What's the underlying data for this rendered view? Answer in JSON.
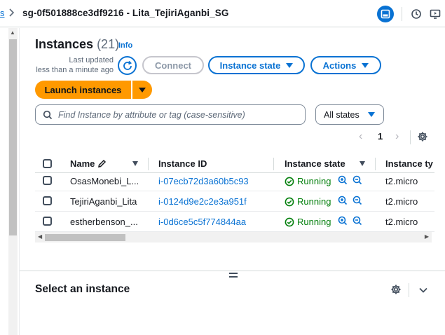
{
  "breadcrumb": {
    "prev_fragment": "s",
    "current": "sg-0f501888ce3df9216 - Lita_TejiriAganbi_SG"
  },
  "top_icons": [
    "panel-icon",
    "clock-icon",
    "tutorial-icon"
  ],
  "header": {
    "title": "Instances",
    "count": "(21)",
    "info": "Info",
    "updated_line1": "Last updated",
    "updated_line2": "less than a minute ago"
  },
  "buttons": {
    "connect": "Connect",
    "instance_state": "Instance state",
    "actions": "Actions",
    "launch": "Launch instances"
  },
  "search": {
    "placeholder": "Find Instance by attribute or tag (case-sensitive)"
  },
  "filter": {
    "selected": "All states"
  },
  "pagination": {
    "current": "1"
  },
  "table": {
    "columns": [
      "Name",
      "Instance ID",
      "Instance state",
      "Instance ty"
    ],
    "rows": [
      {
        "name": "OsasMonebi_L...",
        "id": "i-07ecb72d3a60b5c93",
        "state": "Running",
        "type": "t2.micro"
      },
      {
        "name": "TejiriAganbi_Lita",
        "id": "i-0124d9e2c2e3a951f",
        "state": "Running",
        "type": "t2.micro"
      },
      {
        "name": "estherbenson_...",
        "id": "i-0d6ce5c5f774844aa",
        "state": "Running",
        "type": "t2.micro"
      }
    ]
  },
  "split_panel": {
    "title": "Select an instance"
  },
  "colors": {
    "link": "#0972d3",
    "primary": "#ff9900",
    "running": "#037f0c",
    "text": "#16191f"
  }
}
